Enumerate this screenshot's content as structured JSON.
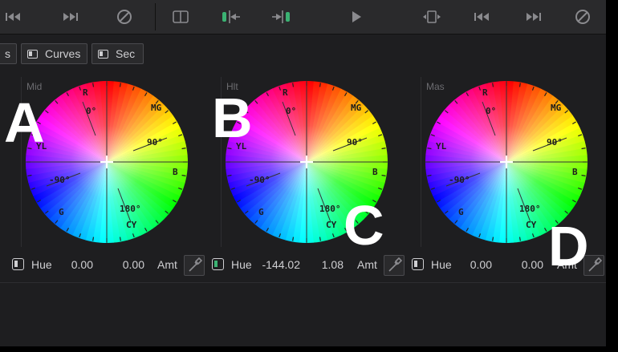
{
  "toolbar": {
    "icons": [
      "rewind-icon",
      "fast-forward-icon",
      "disable-icon",
      "split-view-icon",
      "mark-in-icon",
      "mark-out-icon",
      "play-icon",
      "loop-icon",
      "rewind-icon",
      "fast-forward-icon",
      "disable-icon"
    ]
  },
  "tabs": [
    {
      "label": "s"
    },
    {
      "label": "Curves"
    },
    {
      "label": "Sec"
    }
  ],
  "wheels": [
    {
      "label": "Mid",
      "marker_letter": "A"
    },
    {
      "label": "Hlt",
      "marker_letter": "B"
    },
    {
      "label": "Mas",
      "marker_letter": ""
    }
  ],
  "wheel_markings": {
    "r": "R",
    "mg": "MG",
    "yl": "YL",
    "b": "B",
    "g": "G",
    "cy": "CY",
    "deg0": "0°",
    "deg90": "90°",
    "degm90": "-90°",
    "deg180": "180°"
  },
  "annotations": {
    "c": "C",
    "d": "D"
  },
  "controls": [
    {
      "checked": false,
      "hue_label": "Hue",
      "hue_value": "0.00",
      "amt_value": "0.00",
      "amt_label": "Amt"
    },
    {
      "checked": true,
      "hue_label": "Hue",
      "hue_value": "-144.02",
      "amt_value": "1.08",
      "amt_label": "Amt"
    },
    {
      "checked": false,
      "hue_label": "Hue",
      "hue_value": "0.00",
      "amt_value": "0.00",
      "amt_label": "Amt"
    }
  ],
  "colors": {
    "accent_green": "#3bb273",
    "panel_bg": "#1e1e20",
    "toolbar_bg": "#2a2a2c"
  }
}
